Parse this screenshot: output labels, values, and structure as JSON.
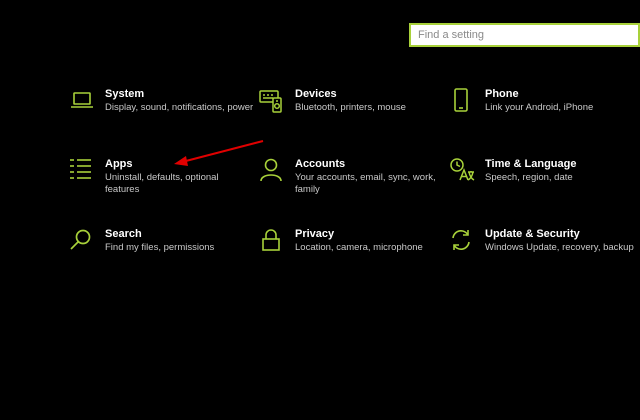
{
  "search": {
    "placeholder": "Find a setting",
    "value": ""
  },
  "accent_color": "#a8d13a",
  "annotation_arrow_color": "#e00000",
  "tiles": [
    {
      "title": "System",
      "desc": "Display, sound, notifications, power",
      "icon": "monitor-icon"
    },
    {
      "title": "Devices",
      "desc": "Bluetooth, printers, mouse",
      "icon": "keyboard-speaker-icon"
    },
    {
      "title": "Phone",
      "desc": "Link your Android, iPhone",
      "icon": "phone-icon"
    },
    {
      "title": "Apps",
      "desc": "Uninstall, defaults, optional features",
      "icon": "apps-list-icon"
    },
    {
      "title": "Accounts",
      "desc": "Your accounts, email, sync, work, family",
      "icon": "person-icon"
    },
    {
      "title": "Time & Language",
      "desc": "Speech, region, date",
      "icon": "time-language-icon"
    },
    {
      "title": "Search",
      "desc": "Find my files, permissions",
      "icon": "search-icon"
    },
    {
      "title": "Privacy",
      "desc": "Location, camera, microphone",
      "icon": "lock-icon"
    },
    {
      "title": "Update & Security",
      "desc": "Windows Update, recovery, backup",
      "icon": "sync-icon"
    }
  ]
}
